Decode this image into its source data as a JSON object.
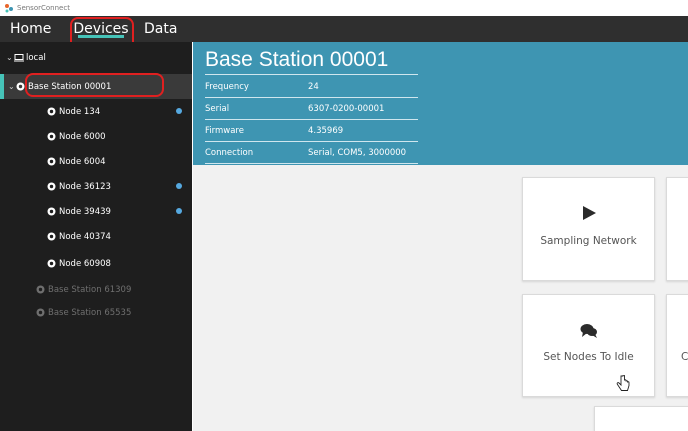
{
  "window": {
    "title": "SensorConnect",
    "app_icon": "sensorconnect-logo-icon"
  },
  "nav": {
    "tabs": [
      {
        "label": "Home"
      },
      {
        "label": "Devices"
      },
      {
        "label": "Data"
      }
    ],
    "active_tab": "Devices",
    "accent_color": "#46c3b8"
  },
  "tree": {
    "root": {
      "label": "local",
      "icon": "computer-icon"
    },
    "items": [
      {
        "label": "Base Station 00001",
        "type": "base-station",
        "state": "selected",
        "icon": "radio-icon",
        "chevron": "chevron-down-icon"
      },
      {
        "label": "Node 134",
        "type": "node",
        "state": "active",
        "icon": "radio-icon",
        "indicator": true
      },
      {
        "label": "Node 6000",
        "type": "node",
        "state": "active",
        "icon": "radio-icon",
        "indicator": false
      },
      {
        "label": "Node 6004",
        "type": "node",
        "state": "active",
        "icon": "radio-icon",
        "indicator": false
      },
      {
        "label": "Node 36123",
        "type": "node",
        "state": "active",
        "icon": "radio-icon",
        "indicator": true
      },
      {
        "label": "Node 39439",
        "type": "node",
        "state": "active",
        "icon": "radio-icon",
        "indicator": true
      },
      {
        "label": "Node 40374",
        "type": "node",
        "state": "active",
        "icon": "radio-icon",
        "indicator": false
      },
      {
        "label": "Node 60908",
        "type": "node",
        "state": "active",
        "icon": "radio-icon",
        "indicator": false
      },
      {
        "label": "Base Station 61309",
        "type": "base-station",
        "state": "disabled",
        "icon": "radio-icon"
      },
      {
        "label": "Base Station 65535",
        "type": "base-station",
        "state": "disabled",
        "icon": "radio-icon"
      }
    ],
    "indicator_color": "#56a9e0"
  },
  "device": {
    "title": "Base Station 00001",
    "header_color": "#3e95b2",
    "info": [
      {
        "label": "Frequency",
        "value": "24"
      },
      {
        "label": "Serial",
        "value": "6307-0200-00001"
      },
      {
        "label": "Firmware",
        "value": "4.35969"
      },
      {
        "label": "Connection",
        "value": "Serial, COM5, 3000000"
      }
    ]
  },
  "actions": {
    "cards": [
      {
        "label": "Sampling Network",
        "icon": "play-icon"
      },
      {
        "label": "",
        "icon": ""
      },
      {
        "label": "Set Nodes To Idle",
        "icon": "chat-bubbles-icon"
      },
      {
        "label": "C",
        "icon": ""
      }
    ]
  },
  "annotations": {
    "highlight_color": "#e02020"
  }
}
